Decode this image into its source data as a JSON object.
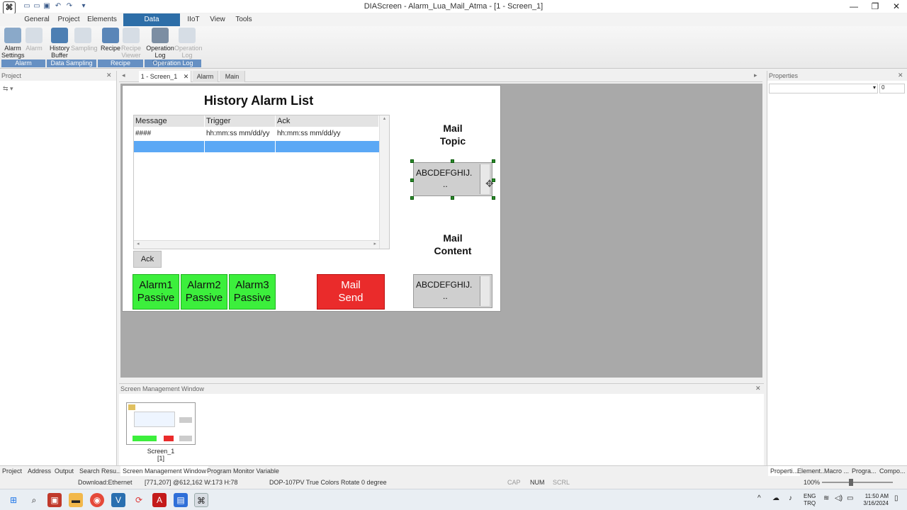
{
  "window": {
    "title": "DIAScreen - Alarm_Lua_Mail_Atma - [1 - Screen_1]",
    "app_icon_glyph": "⌘",
    "min_glyph": "—",
    "max_glyph": "❐",
    "close_glyph": "✕"
  },
  "ribbon": {
    "tabs": [
      {
        "label": "General"
      },
      {
        "label": "Project"
      },
      {
        "label": "Elements"
      },
      {
        "label": "Data Management",
        "active": true
      },
      {
        "label": "IIoT"
      },
      {
        "label": "View"
      },
      {
        "label": "Tools"
      }
    ],
    "buttons": {
      "alarm_settings": "Alarm Settings",
      "alarm": "Alarm",
      "history_buffer": "History Buffer",
      "sampling": "Sampling",
      "recipe": "Recipe",
      "recipe_viewer": "Recipe Viewer",
      "operation_log_setup": "Operation Log Setup",
      "operation_log": "Operation Log"
    },
    "groups": {
      "alarm": "Alarm",
      "data_sampling": "Data Sampling",
      "recipe": "Recipe",
      "operation_log": "Operation Log"
    }
  },
  "panels": {
    "project": "Project",
    "properties": "Properties",
    "properties_value": "0"
  },
  "doc_tabs": [
    {
      "label": "1 - Screen_1",
      "active": true
    },
    {
      "label": "Alarm"
    },
    {
      "label": "Main"
    }
  ],
  "screen": {
    "title": "History Alarm List",
    "table": {
      "headers": [
        "Message",
        "Trigger",
        "Ack"
      ],
      "rows": [
        [
          "####",
          "hh:mm:ss mm/dd/yy",
          "hh:mm:ss mm/dd/yy"
        ]
      ]
    },
    "ack_label": "Ack",
    "alarm_buttons": [
      {
        "line1": "Alarm1",
        "line2": "Passive"
      },
      {
        "line1": "Alarm2",
        "line2": "Passive"
      },
      {
        "line1": "Alarm3",
        "line2": "Passive"
      }
    ],
    "mail_send": {
      "line1": "Mail",
      "line2": "Send"
    },
    "mail_topic": {
      "line1": "Mail",
      "line2": "Topic",
      "box_line1": "ABCDEFGHIJ.",
      "box_line2": ".."
    },
    "mail_content": {
      "line1": "Mail",
      "line2": "Content",
      "box_line1": "ABCDEFGHIJ.",
      "box_line2": ".."
    },
    "colors": {
      "green": "#3cef3c",
      "red": "#ea2b2b",
      "selected_row": "#5ba8f5"
    }
  },
  "screen_management": {
    "title": "Screen Management Window",
    "thumb_name": "Screen_1",
    "thumb_id": "[1]"
  },
  "bottom_tabs": [
    {
      "label": "Project"
    },
    {
      "label": "Address"
    },
    {
      "label": "Output"
    },
    {
      "label": "Search Resu..."
    },
    {
      "label": "Screen Management Window",
      "active": true
    },
    {
      "label": "Program Monitor Variable"
    }
  ],
  "right_bottom_tabs": [
    {
      "label": "Properti..."
    },
    {
      "label": "Element..."
    },
    {
      "label": "Macro ..."
    },
    {
      "label": "Progra..."
    },
    {
      "label": "Compo..."
    }
  ],
  "status": {
    "download": "Download:Ethernet",
    "coords": "[771,207] @612,162 W:173 H:78",
    "device": "DOP-107PV True Colors Rotate 0 degree",
    "cap": "CAP",
    "num": "NUM",
    "scrl": "SCRL",
    "zoom": "100%"
  },
  "taskbar": {
    "lang1": "ENG",
    "lang2": "TRQ",
    "time": "11:50 AM",
    "date": "3/16/2024"
  }
}
